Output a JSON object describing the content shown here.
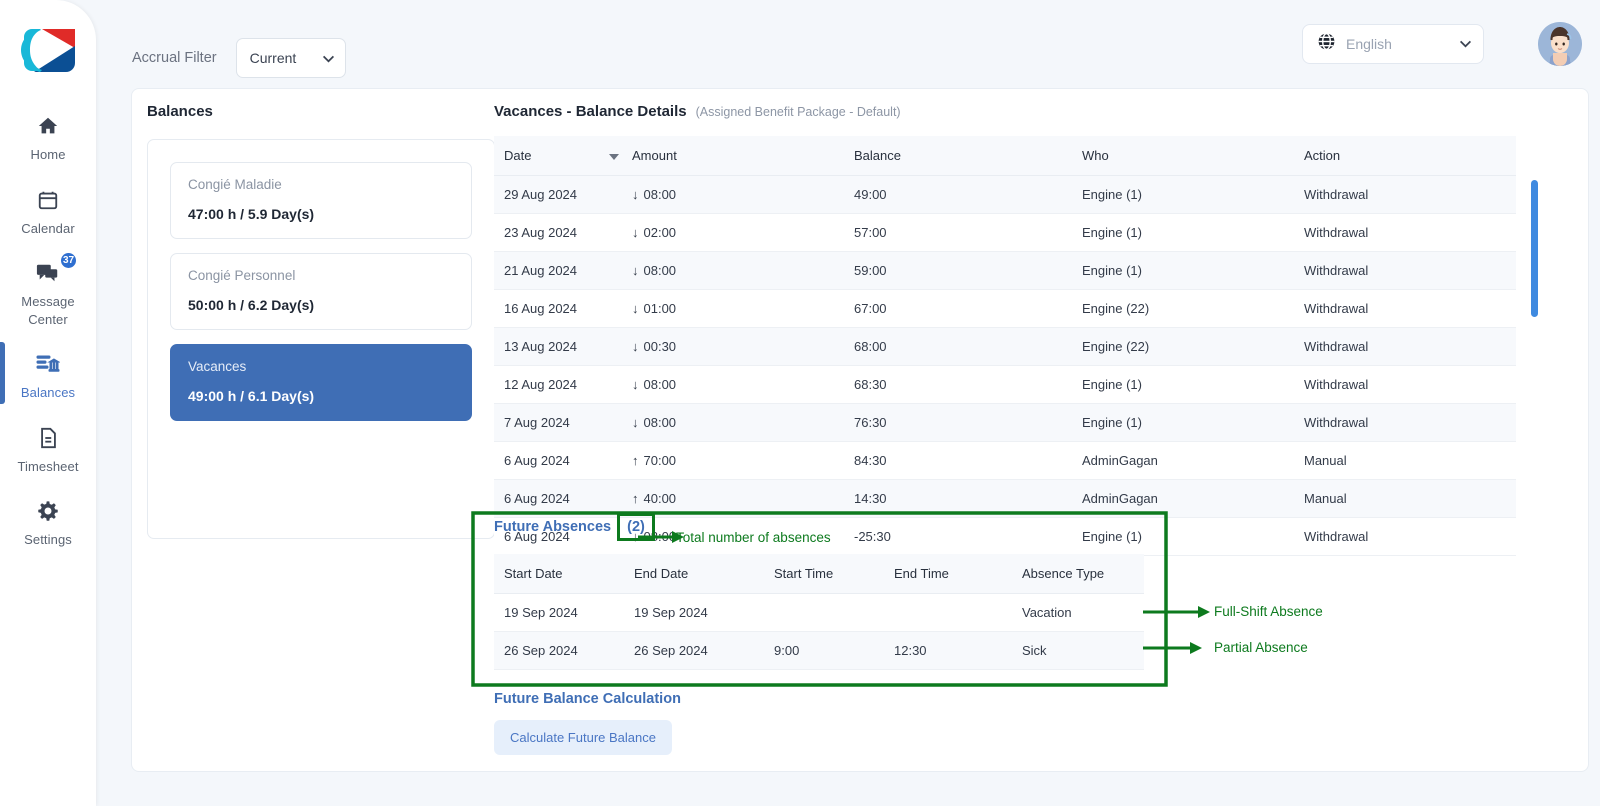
{
  "sidebar": {
    "logo_name": "company-logo",
    "items": [
      {
        "label": "Home",
        "icon": "home-icon",
        "active": false,
        "badge": ""
      },
      {
        "label": "Calendar",
        "icon": "calendar-icon",
        "active": false,
        "badge": ""
      },
      {
        "label": "Message Center",
        "icon": "message-icon",
        "active": false,
        "badge": "37"
      },
      {
        "label": "Balances",
        "icon": "balances-icon",
        "active": true,
        "badge": ""
      },
      {
        "label": "Timesheet",
        "icon": "timesheet-icon",
        "active": false,
        "badge": ""
      },
      {
        "label": "Settings",
        "icon": "gear-icon",
        "active": false,
        "badge": ""
      }
    ]
  },
  "topbar": {
    "accrual_filter_label": "Accrual Filter",
    "accrual_filter_value": "Current",
    "language_value": "English",
    "language_icon": "globe-icon",
    "avatar_name": "user-avatar"
  },
  "balances_panel": {
    "title": "Balances",
    "cards": [
      {
        "name": "Congié Maladie",
        "value": "47:00 h / 5.9 Day(s)",
        "selected": false
      },
      {
        "name": "Congié Personnel",
        "value": "50:00 h / 6.2 Day(s)",
        "selected": false
      },
      {
        "name": "Vacances",
        "value": "49:00 h / 6.1 Day(s)",
        "selected": true
      }
    ]
  },
  "details": {
    "title": "Vacances - Balance Details",
    "subtitle": "(Assigned Benefit Package - Default)",
    "columns": [
      "Date",
      "Amount",
      "Balance",
      "Who",
      "Action"
    ],
    "sort_column": "Date",
    "sort_direction": "desc",
    "rows": [
      {
        "date": "29 Aug 2024",
        "dir": "down",
        "amount": "08:00",
        "balance": "49:00",
        "who": "Engine (1)",
        "action": "Withdrawal"
      },
      {
        "date": "23 Aug 2024",
        "dir": "down",
        "amount": "02:00",
        "balance": "57:00",
        "who": "Engine (1)",
        "action": "Withdrawal"
      },
      {
        "date": "21 Aug 2024",
        "dir": "down",
        "amount": "08:00",
        "balance": "59:00",
        "who": "Engine (1)",
        "action": "Withdrawal"
      },
      {
        "date": "16 Aug 2024",
        "dir": "down",
        "amount": "01:00",
        "balance": "67:00",
        "who": "Engine (22)",
        "action": "Withdrawal"
      },
      {
        "date": "13 Aug 2024",
        "dir": "down",
        "amount": "00:30",
        "balance": "68:00",
        "who": "Engine (22)",
        "action": "Withdrawal"
      },
      {
        "date": "12 Aug 2024",
        "dir": "down",
        "amount": "08:00",
        "balance": "68:30",
        "who": "Engine (1)",
        "action": "Withdrawal"
      },
      {
        "date": "7 Aug 2024",
        "dir": "down",
        "amount": "08:00",
        "balance": "76:30",
        "who": "Engine (1)",
        "action": "Withdrawal"
      },
      {
        "date": "6 Aug 2024",
        "dir": "up",
        "amount": "70:00",
        "balance": "84:30",
        "who": "AdminGagan",
        "action": "Manual"
      },
      {
        "date": "6 Aug 2024",
        "dir": "up",
        "amount": "40:00",
        "balance": "14:30",
        "who": "AdminGagan",
        "action": "Manual"
      },
      {
        "date": "6 Aug 2024",
        "dir": "down",
        "amount": "08:00",
        "balance": "-25:30",
        "who": "Engine (1)",
        "action": "Withdrawal"
      }
    ]
  },
  "future_absences": {
    "title": "Future Absences",
    "count": "(2)",
    "columns": [
      "Start Date",
      "End Date",
      "Start Time",
      "End Time",
      "Absence Type"
    ],
    "rows": [
      {
        "start_date": "19 Sep 2024",
        "end_date": "19 Sep 2024",
        "start_time": "",
        "end_time": "",
        "type": "Vacation"
      },
      {
        "start_date": "26 Sep 2024",
        "end_date": "26 Sep 2024",
        "start_time": "9:00",
        "end_time": "12:30",
        "type": "Sick"
      }
    ]
  },
  "future_balance": {
    "title": "Future Balance Calculation",
    "button_label": "Calculate Future Balance"
  },
  "annotations": {
    "color": "#0d7a1e",
    "items": [
      {
        "text": "Total number of absences"
      },
      {
        "text": "Full-Shift Absence"
      },
      {
        "text": "Partial Absence"
      }
    ]
  },
  "colors": {
    "accent_blue": "#3f6eb5",
    "link_blue": "#4a76c4",
    "annotation_green": "#0d7a1e",
    "page_bg": "#f4f7fb",
    "scrollbar": "#3f8ae0"
  }
}
